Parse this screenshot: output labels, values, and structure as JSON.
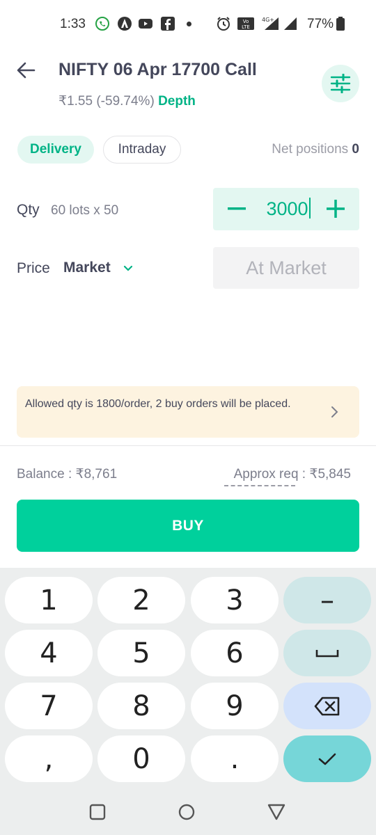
{
  "status_bar": {
    "time": "1:33",
    "battery": "77%",
    "network": "4G+"
  },
  "header": {
    "title": "NIFTY 06 Apr 17700 Call",
    "price_change": "₹1.55 (-59.74%)",
    "depth_label": "Depth"
  },
  "tabs": {
    "delivery": "Delivery",
    "intraday": "Intraday"
  },
  "net_positions": {
    "label": "Net positions",
    "value": "0"
  },
  "qty": {
    "label": "Qty",
    "lots": "60 lots x 50",
    "value": "3000"
  },
  "price": {
    "label": "Price",
    "type": "Market",
    "field": "At Market"
  },
  "notice": {
    "text": "Allowed qty is 1800/order, 2 buy orders will be placed."
  },
  "balance": {
    "text": "Balance : ₹8,761"
  },
  "approx": {
    "text": "Approx req : ₹5,845"
  },
  "buy_button": {
    "label": "BUY"
  },
  "keyboard": {
    "keys": [
      "1",
      "2",
      "3",
      "4",
      "5",
      "6",
      "7",
      "8",
      "9",
      ",",
      "0",
      "."
    ],
    "minus": "–"
  },
  "colors": {
    "accent": "#00d09c",
    "accent_text": "#00b386",
    "notice_bg": "#fdf3e0"
  },
  "icons": [
    "whatsapp-icon",
    "app-icon",
    "youtube-icon",
    "facebook-icon",
    "alarm-icon",
    "signal-icon",
    "battery-icon",
    "back-arrow-icon",
    "sliders-icon",
    "chevron-down-icon",
    "chevron-right-icon",
    "backspace-icon",
    "space-icon",
    "check-icon",
    "square-icon",
    "circle-icon",
    "triangle-icon"
  ]
}
